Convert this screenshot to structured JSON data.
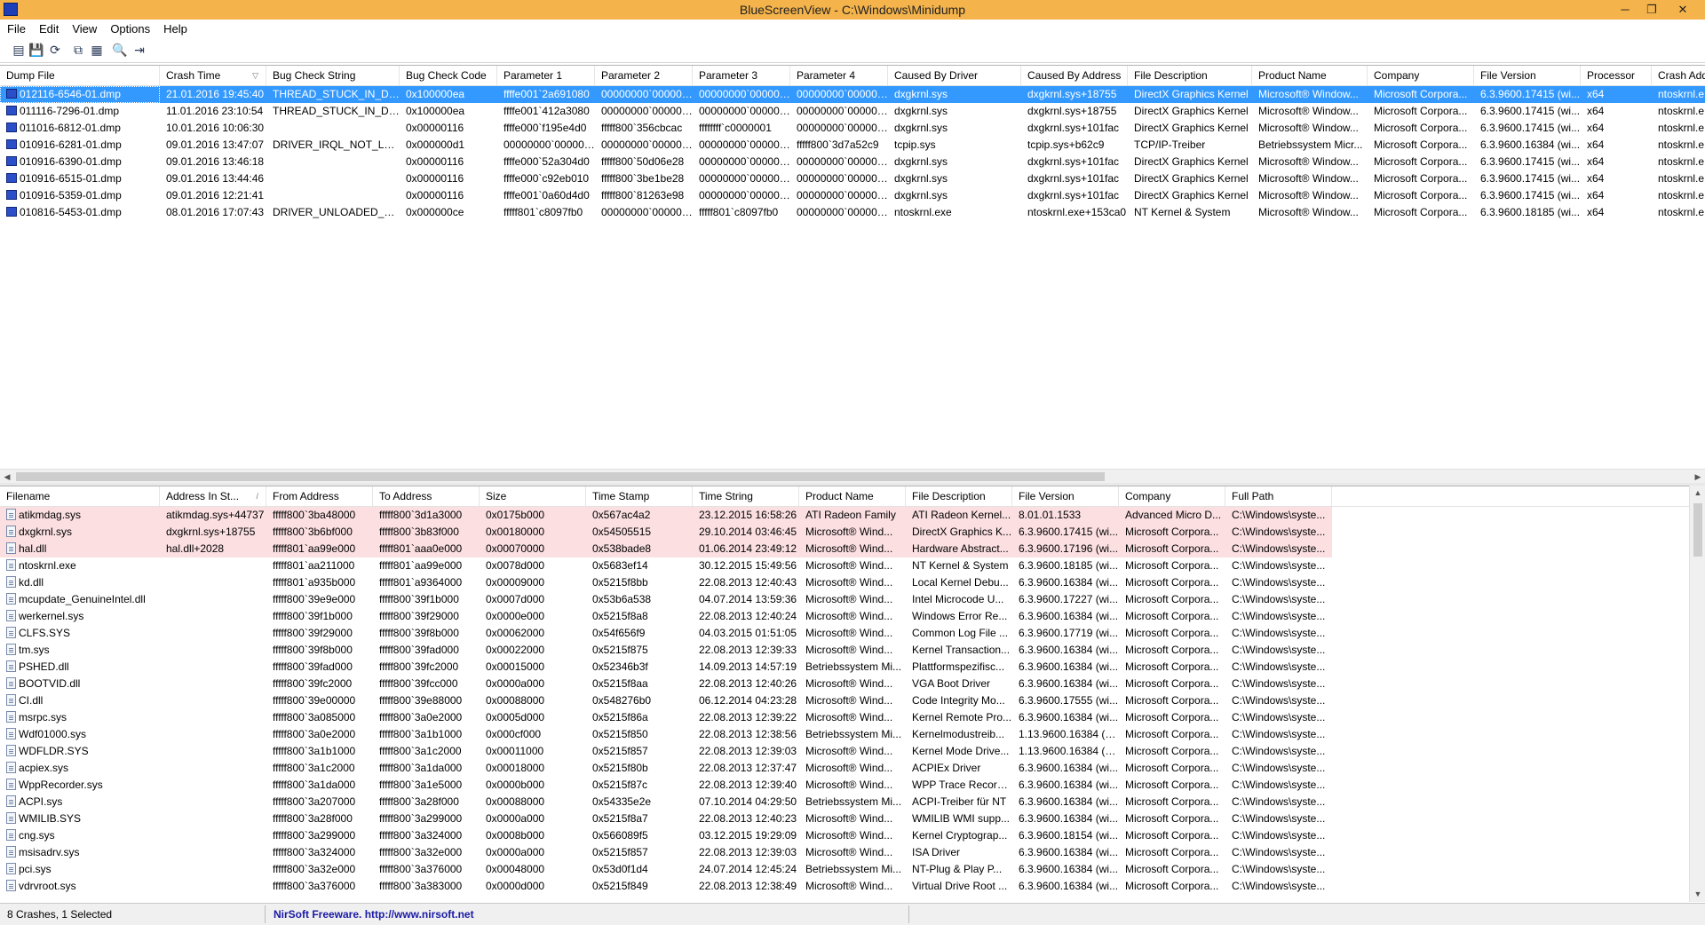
{
  "window": {
    "title": "BlueScreenView  -  C:\\Windows\\Minidump",
    "minimize_glyph": "─",
    "maximize_glyph": "❐",
    "close_glyph": "✕"
  },
  "menu": [
    "File",
    "Edit",
    "View",
    "Options",
    "Help"
  ],
  "toolbar": {
    "icons": [
      "html-report-icon",
      "save-icon",
      "refresh-icon",
      "copy-icon",
      "properties-icon",
      "find-icon",
      "exit-icon"
    ],
    "glyphs": [
      "▤",
      "💾",
      "⟳",
      "⧉",
      "▦",
      "🔍",
      "⇥"
    ]
  },
  "crash_list": {
    "columns": [
      "Dump File",
      "Crash Time",
      "Bug Check String",
      "Bug Check Code",
      "Parameter 1",
      "Parameter 2",
      "Parameter 3",
      "Parameter 4",
      "Caused By Driver",
      "Caused By Address",
      "File Description",
      "Product Name",
      "Company",
      "File Version",
      "Processor",
      "Crash Address"
    ],
    "sorted_column_glyph": "▽",
    "rows": [
      [
        "012116-6546-01.dmp",
        "21.01.2016 19:45:40",
        "THREAD_STUCK_IN_DEV...",
        "0x100000ea",
        "ffffe001`2a691080",
        "00000000`000000...",
        "00000000`000000...",
        "00000000`000000...",
        "dxgkrnl.sys",
        "dxgkrnl.sys+18755",
        "DirectX Graphics Kernel",
        "Microsoft® Window...",
        "Microsoft Corpora...",
        "6.3.9600.17415 (wi...",
        "x64",
        "ntoskrnl.e"
      ],
      [
        "011116-7296-01.dmp",
        "11.01.2016 23:10:54",
        "THREAD_STUCK_IN_DEV...",
        "0x100000ea",
        "ffffe001`412a3080",
        "00000000`000000...",
        "00000000`000000...",
        "00000000`000000...",
        "dxgkrnl.sys",
        "dxgkrnl.sys+18755",
        "DirectX Graphics Kernel",
        "Microsoft® Window...",
        "Microsoft Corpora...",
        "6.3.9600.17415 (wi...",
        "x64",
        "ntoskrnl.e"
      ],
      [
        "011016-6812-01.dmp",
        "10.01.2016 10:06:30",
        "",
        "0x00000116",
        "ffffe000`f195e4d0",
        "fffff800`356cbcac",
        "ffffffff`c0000001",
        "00000000`000000...",
        "dxgkrnl.sys",
        "dxgkrnl.sys+101fac",
        "DirectX Graphics Kernel",
        "Microsoft® Window...",
        "Microsoft Corpora...",
        "6.3.9600.17415 (wi...",
        "x64",
        "ntoskrnl.e"
      ],
      [
        "010916-6281-01.dmp",
        "09.01.2016 13:47:07",
        "DRIVER_IRQL_NOT_LESS...",
        "0x000000d1",
        "00000000`000000...",
        "00000000`000000...",
        "00000000`000000...",
        "fffff800`3d7a52c9",
        "tcpip.sys",
        "tcpip.sys+b62c9",
        "TCP/IP-Treiber",
        "Betriebssystem Micr...",
        "Microsoft Corpora...",
        "6.3.9600.16384 (wi...",
        "x64",
        "ntoskrnl.e"
      ],
      [
        "010916-6390-01.dmp",
        "09.01.2016 13:46:18",
        "",
        "0x00000116",
        "ffffe000`52a304d0",
        "fffff800`50d06e28",
        "00000000`000000...",
        "00000000`000000...",
        "dxgkrnl.sys",
        "dxgkrnl.sys+101fac",
        "DirectX Graphics Kernel",
        "Microsoft® Window...",
        "Microsoft Corpora...",
        "6.3.9600.17415 (wi...",
        "x64",
        "ntoskrnl.e"
      ],
      [
        "010916-6515-01.dmp",
        "09.01.2016 13:44:46",
        "",
        "0x00000116",
        "ffffe000`c92eb010",
        "fffff800`3be1be28",
        "00000000`000000...",
        "00000000`000000...",
        "dxgkrnl.sys",
        "dxgkrnl.sys+101fac",
        "DirectX Graphics Kernel",
        "Microsoft® Window...",
        "Microsoft Corpora...",
        "6.3.9600.17415 (wi...",
        "x64",
        "ntoskrnl.e"
      ],
      [
        "010916-5359-01.dmp",
        "09.01.2016 12:21:41",
        "",
        "0x00000116",
        "ffffe001`0a60d4d0",
        "fffff800`81263e98",
        "00000000`000000...",
        "00000000`000000...",
        "dxgkrnl.sys",
        "dxgkrnl.sys+101fac",
        "DirectX Graphics Kernel",
        "Microsoft® Window...",
        "Microsoft Corpora...",
        "6.3.9600.17415 (wi...",
        "x64",
        "ntoskrnl.e"
      ],
      [
        "010816-5453-01.dmp",
        "08.01.2016 17:07:43",
        "DRIVER_UNLOADED_WI...",
        "0x000000ce",
        "fffff801`c8097fb0",
        "00000000`000000...",
        "fffff801`c8097fb0",
        "00000000`000000...",
        "ntoskrnl.exe",
        "ntoskrnl.exe+153ca0",
        "NT Kernel & System",
        "Microsoft® Window...",
        "Microsoft Corpora...",
        "6.3.9600.18185 (wi...",
        "x64",
        "ntoskrnl.e"
      ]
    ],
    "selected_row": 0
  },
  "driver_list": {
    "columns": [
      "Filename",
      "Address In St...",
      "From Address",
      "To Address",
      "Size",
      "Time Stamp",
      "Time String",
      "Product Name",
      "File Description",
      "File Version",
      "Company",
      "Full Path"
    ],
    "sorted_column_glyph": "/",
    "rows": [
      [
        "atikmdag.sys",
        "atikmdag.sys+44737",
        "fffff800`3ba48000",
        "fffff800`3d1a3000",
        "0x0175b000",
        "0x567ac4a2",
        "23.12.2015 16:58:26",
        "ATI Radeon Family",
        "ATI Radeon Kernel...",
        "8.01.01.1533",
        "Advanced Micro D...",
        "C:\\Windows\\syste..."
      ],
      [
        "dxgkrnl.sys",
        "dxgkrnl.sys+18755",
        "fffff800`3b6bf000",
        "fffff800`3b83f000",
        "0x00180000",
        "0x54505515",
        "29.10.2014 03:46:45",
        "Microsoft® Wind...",
        "DirectX Graphics K...",
        "6.3.9600.17415 (wi...",
        "Microsoft Corpora...",
        "C:\\Windows\\syste..."
      ],
      [
        "hal.dll",
        "hal.dll+2028",
        "fffff801`aa99e000",
        "fffff801`aaa0e000",
        "0x00070000",
        "0x538bade8",
        "01.06.2014 23:49:12",
        "Microsoft® Wind...",
        "Hardware Abstract...",
        "6.3.9600.17196 (wi...",
        "Microsoft Corpora...",
        "C:\\Windows\\syste..."
      ],
      [
        "ntoskrnl.exe",
        "",
        "fffff801`aa211000",
        "fffff801`aa99e000",
        "0x0078d000",
        "0x5683ef14",
        "30.12.2015 15:49:56",
        "Microsoft® Wind...",
        "NT Kernel & System",
        "6.3.9600.18185 (wi...",
        "Microsoft Corpora...",
        "C:\\Windows\\syste..."
      ],
      [
        "kd.dll",
        "",
        "fffff801`a935b000",
        "fffff801`a9364000",
        "0x00009000",
        "0x5215f8bb",
        "22.08.2013 12:40:43",
        "Microsoft® Wind...",
        "Local Kernel Debu...",
        "6.3.9600.16384 (wi...",
        "Microsoft Corpora...",
        "C:\\Windows\\syste..."
      ],
      [
        "mcupdate_GenuineIntel.dll",
        "",
        "fffff800`39e9e000",
        "fffff800`39f1b000",
        "0x0007d000",
        "0x53b6a538",
        "04.07.2014 13:59:36",
        "Microsoft® Wind...",
        "Intel Microcode U...",
        "6.3.9600.17227 (wi...",
        "Microsoft Corpora...",
        "C:\\Windows\\syste..."
      ],
      [
        "werkernel.sys",
        "",
        "fffff800`39f1b000",
        "fffff800`39f29000",
        "0x0000e000",
        "0x5215f8a8",
        "22.08.2013 12:40:24",
        "Microsoft® Wind...",
        "Windows Error Re...",
        "6.3.9600.16384 (wi...",
        "Microsoft Corpora...",
        "C:\\Windows\\syste..."
      ],
      [
        "CLFS.SYS",
        "",
        "fffff800`39f29000",
        "fffff800`39f8b000",
        "0x00062000",
        "0x54f656f9",
        "04.03.2015 01:51:05",
        "Microsoft® Wind...",
        "Common Log File ...",
        "6.3.9600.17719 (wi...",
        "Microsoft Corpora...",
        "C:\\Windows\\syste..."
      ],
      [
        "tm.sys",
        "",
        "fffff800`39f8b000",
        "fffff800`39fad000",
        "0x00022000",
        "0x5215f875",
        "22.08.2013 12:39:33",
        "Microsoft® Wind...",
        "Kernel Transaction...",
        "6.3.9600.16384 (wi...",
        "Microsoft Corpora...",
        "C:\\Windows\\syste..."
      ],
      [
        "PSHED.dll",
        "",
        "fffff800`39fad000",
        "fffff800`39fc2000",
        "0x00015000",
        "0x52346b3f",
        "14.09.2013 14:57:19",
        "Betriebssystem Mi...",
        "Plattformspezifisc...",
        "6.3.9600.16384 (wi...",
        "Microsoft Corpora...",
        "C:\\Windows\\syste..."
      ],
      [
        "BOOTVID.dll",
        "",
        "fffff800`39fc2000",
        "fffff800`39fcc000",
        "0x0000a000",
        "0x5215f8aa",
        "22.08.2013 12:40:26",
        "Microsoft® Wind...",
        "VGA Boot Driver",
        "6.3.9600.16384 (wi...",
        "Microsoft Corpora...",
        "C:\\Windows\\syste..."
      ],
      [
        "CI.dll",
        "",
        "fffff800`39e00000",
        "fffff800`39e88000",
        "0x00088000",
        "0x548276b0",
        "06.12.2014 04:23:28",
        "Microsoft® Wind...",
        "Code Integrity Mo...",
        "6.3.9600.17555 (wi...",
        "Microsoft Corpora...",
        "C:\\Windows\\syste..."
      ],
      [
        "msrpc.sys",
        "",
        "fffff800`3a085000",
        "fffff800`3a0e2000",
        "0x0005d000",
        "0x5215f86a",
        "22.08.2013 12:39:22",
        "Microsoft® Wind...",
        "Kernel Remote Pro...",
        "6.3.9600.16384 (wi...",
        "Microsoft Corpora...",
        "C:\\Windows\\syste..."
      ],
      [
        "Wdf01000.sys",
        "",
        "fffff800`3a0e2000",
        "fffff800`3a1b1000",
        "0x000cf000",
        "0x5215f850",
        "22.08.2013 12:38:56",
        "Betriebssystem Mi...",
        "Kernelmodustreib...",
        "1.13.9600.16384 (w...",
        "Microsoft Corpora...",
        "C:\\Windows\\syste..."
      ],
      [
        "WDFLDR.SYS",
        "",
        "fffff800`3a1b1000",
        "fffff800`3a1c2000",
        "0x00011000",
        "0x5215f857",
        "22.08.2013 12:39:03",
        "Microsoft® Wind...",
        "Kernel Mode Drive...",
        "1.13.9600.16384 (w...",
        "Microsoft Corpora...",
        "C:\\Windows\\syste..."
      ],
      [
        "acpiex.sys",
        "",
        "fffff800`3a1c2000",
        "fffff800`3a1da000",
        "0x00018000",
        "0x5215f80b",
        "22.08.2013 12:37:47",
        "Microsoft® Wind...",
        "ACPIEx Driver",
        "6.3.9600.16384 (wi...",
        "Microsoft Corpora...",
        "C:\\Windows\\syste..."
      ],
      [
        "WppRecorder.sys",
        "",
        "fffff800`3a1da000",
        "fffff800`3a1e5000",
        "0x0000b000",
        "0x5215f87c",
        "22.08.2013 12:39:40",
        "Microsoft® Wind...",
        "WPP Trace Recorder",
        "6.3.9600.16384 (wi...",
        "Microsoft Corpora...",
        "C:\\Windows\\syste..."
      ],
      [
        "ACPI.sys",
        "",
        "fffff800`3a207000",
        "fffff800`3a28f000",
        "0x00088000",
        "0x54335e2e",
        "07.10.2014 04:29:50",
        "Betriebssystem Mi...",
        "ACPI-Treiber für NT",
        "6.3.9600.16384 (wi...",
        "Microsoft Corpora...",
        "C:\\Windows\\syste..."
      ],
      [
        "WMILIB.SYS",
        "",
        "fffff800`3a28f000",
        "fffff800`3a299000",
        "0x0000a000",
        "0x5215f8a7",
        "22.08.2013 12:40:23",
        "Microsoft® Wind...",
        "WMILIB WMI supp...",
        "6.3.9600.16384 (wi...",
        "Microsoft Corpora...",
        "C:\\Windows\\syste..."
      ],
      [
        "cng.sys",
        "",
        "fffff800`3a299000",
        "fffff800`3a324000",
        "0x0008b000",
        "0x566089f5",
        "03.12.2015 19:29:09",
        "Microsoft® Wind...",
        "Kernel Cryptograp...",
        "6.3.9600.18154 (wi...",
        "Microsoft Corpora...",
        "C:\\Windows\\syste..."
      ],
      [
        "msisadrv.sys",
        "",
        "fffff800`3a324000",
        "fffff800`3a32e000",
        "0x0000a000",
        "0x5215f857",
        "22.08.2013 12:39:03",
        "Microsoft® Wind...",
        "ISA Driver",
        "6.3.9600.16384 (wi...",
        "Microsoft Corpora...",
        "C:\\Windows\\syste..."
      ],
      [
        "pci.sys",
        "",
        "fffff800`3a32e000",
        "fffff800`3a376000",
        "0x00048000",
        "0x53d0f1d4",
        "24.07.2014 12:45:24",
        "Betriebssystem Mi...",
        "NT-Plug & Play P...",
        "6.3.9600.16384 (wi...",
        "Microsoft Corpora...",
        "C:\\Windows\\syste..."
      ],
      [
        "vdrvroot.sys",
        "",
        "fffff800`3a376000",
        "fffff800`3a383000",
        "0x0000d000",
        "0x5215f849",
        "22.08.2013 12:38:49",
        "Microsoft® Wind...",
        "Virtual Drive Root ...",
        "6.3.9600.16384 (wi...",
        "Microsoft Corpora...",
        "C:\\Windows\\syste..."
      ]
    ],
    "highlighted_rows": [
      0,
      1,
      2
    ]
  },
  "scroll": {
    "left": "◀",
    "right": "▶",
    "up": "▲",
    "down": "▼"
  },
  "status": {
    "count_text": "8 Crashes, 1 Selected",
    "credit_text": "NirSoft Freeware.  http://www.nirsoft.net"
  },
  "colors": {
    "titlebar": "#f4b34b",
    "selection": "#3399ff",
    "highlight_pink": "#fbdfe1",
    "link": "#1a1aa6"
  }
}
